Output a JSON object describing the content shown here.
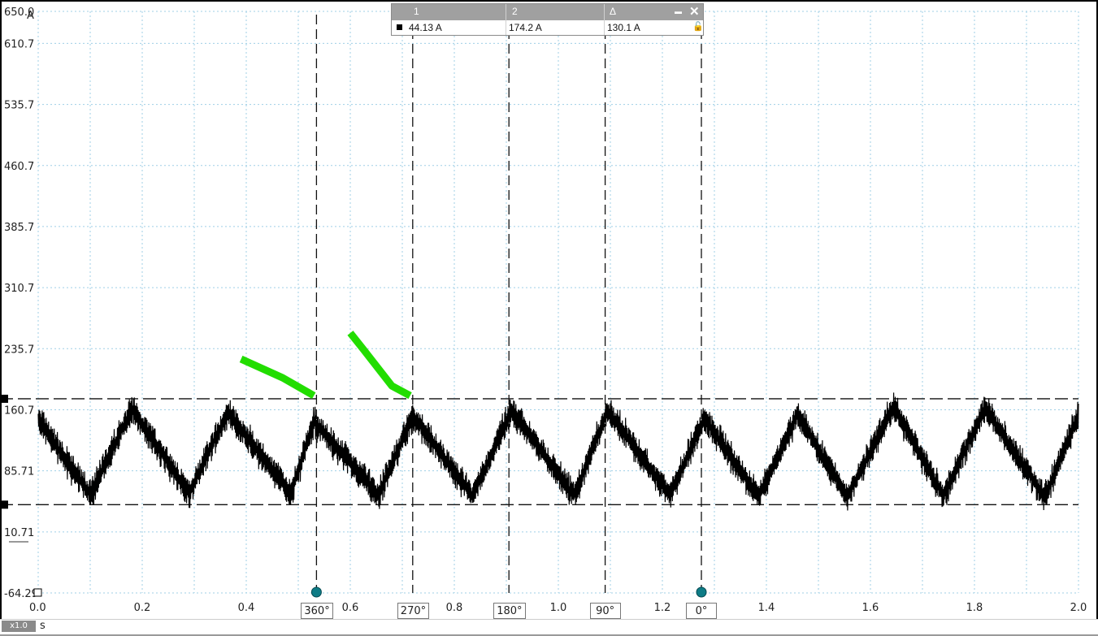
{
  "chart_data": {
    "type": "line",
    "y_unit": "A",
    "x_unit": "s",
    "ylim": [
      -64.29,
      650.0
    ],
    "xlim": [
      0.0,
      2.0
    ],
    "y_ticks": [
      "650.0",
      "610.7",
      "535.7",
      "460.7",
      "385.7",
      "310.7",
      "235.7",
      "160.7",
      "85.71",
      "10.71",
      "-64.29"
    ],
    "y_tick_values": [
      650.0,
      610.7,
      535.7,
      460.7,
      385.7,
      310.7,
      235.7,
      160.7,
      85.71,
      10.71,
      -64.29
    ],
    "x_ticks": [
      "0.0",
      "0.2",
      "0.4",
      "0.6",
      "0.8",
      "1.0",
      "1.2",
      "1.4",
      "1.6",
      "1.8",
      "2.0"
    ],
    "x_tick_values": [
      0.0,
      0.2,
      0.4,
      0.6,
      0.8,
      1.0,
      1.2,
      1.4,
      1.6,
      1.8,
      2.0
    ],
    "grid": true,
    "series": [
      {
        "color": "#000000",
        "points": [
          [
            0.0,
            148
          ],
          [
            0.1,
            56
          ],
          [
            0.18,
            162
          ],
          [
            0.29,
            58
          ],
          [
            0.365,
            158
          ],
          [
            0.485,
            57
          ],
          [
            0.53,
            146
          ],
          [
            0.655,
            56
          ],
          [
            0.72,
            154
          ],
          [
            0.835,
            55
          ],
          [
            0.91,
            160
          ],
          [
            1.03,
            55
          ],
          [
            1.095,
            160
          ],
          [
            1.215,
            55
          ],
          [
            1.28,
            150
          ],
          [
            1.385,
            54
          ],
          [
            1.46,
            155
          ],
          [
            1.555,
            54
          ],
          [
            1.645,
            165
          ],
          [
            1.74,
            55
          ],
          [
            1.82,
            163
          ],
          [
            1.935,
            53
          ],
          [
            2.0,
            154
          ]
        ]
      }
    ],
    "horizontal_cursors": [
      {
        "label": "1",
        "value": 44.13
      },
      {
        "label": "2",
        "value": 174.2
      }
    ],
    "time_cursors": [
      {
        "time": 0.535,
        "label": "360°"
      },
      {
        "time": 0.72,
        "label": "270°"
      },
      {
        "time": 0.905,
        "label": "180°"
      },
      {
        "time": 1.09,
        "label": "90°"
      },
      {
        "time": 1.275,
        "label": "0°"
      }
    ],
    "annotations": [
      {
        "type": "green-stroke",
        "color": "#22dd00",
        "points": [
          [
            0.39,
            223
          ],
          [
            0.47,
            200
          ],
          [
            0.53,
            178
          ]
        ]
      },
      {
        "type": "green-stroke",
        "color": "#22dd00",
        "points": [
          [
            0.6,
            255
          ],
          [
            0.625,
            235
          ],
          [
            0.68,
            190
          ],
          [
            0.715,
            178
          ]
        ]
      }
    ]
  },
  "measurements": {
    "col1_header": "1",
    "col2_header": "2",
    "delta_header": "Δ",
    "minimize_icon": "▬",
    "close_icon": "✕",
    "value1": "44.13 A",
    "value2": "174.2 A",
    "delta": "130.1 A",
    "lock_icon": "🔓"
  },
  "statusbar": {
    "zoom": "x1.0",
    "x_unit": "s"
  }
}
